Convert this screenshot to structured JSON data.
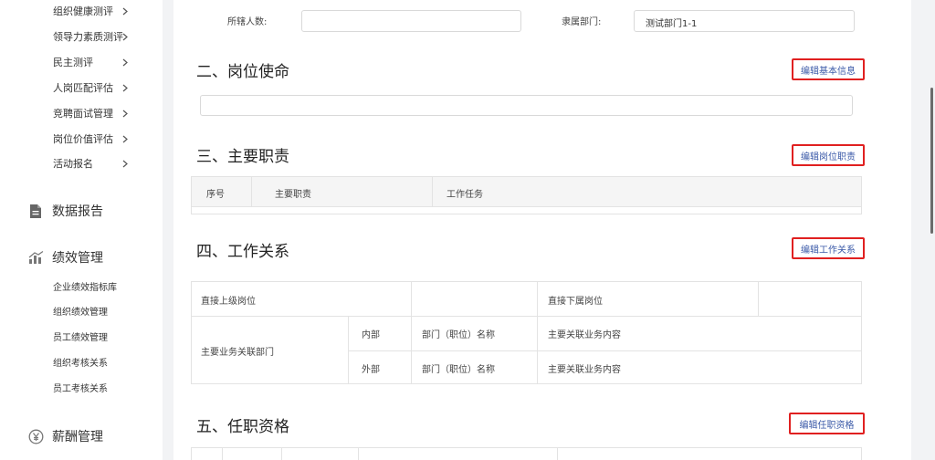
{
  "sidebar": {
    "sub_items": [
      {
        "label": "组织健康测评"
      },
      {
        "label": "领导力素质测评"
      },
      {
        "label": "民主测评"
      },
      {
        "label": "人岗匹配评估"
      },
      {
        "label": "竞聘面试管理"
      },
      {
        "label": "岗位价值评估"
      },
      {
        "label": "活动报名"
      }
    ],
    "data_report": {
      "label": "数据报告",
      "icon": "document-icon"
    },
    "performance": {
      "label": "绩效管理",
      "icon": "bar-chart-icon",
      "items": [
        {
          "label": "企业绩效指标库"
        },
        {
          "label": "组织绩效管理"
        },
        {
          "label": "员工绩效管理"
        },
        {
          "label": "组织考核关系"
        },
        {
          "label": "员工考核关系"
        }
      ]
    },
    "salary": {
      "label": "薪酬管理",
      "icon": "yen-icon"
    }
  },
  "basic_fields": {
    "headcount_label": "所辖人数:",
    "headcount_value": "",
    "department_label": "隶属部门:",
    "department_value": "测试部门1-1"
  },
  "sections": {
    "mission": {
      "title": "二、岗位使命",
      "edit_label": "编辑基本信息",
      "value": ""
    },
    "duties": {
      "title": "三、主要职责",
      "edit_label": "编辑岗位职责",
      "columns": [
        "序号",
        "主要职责",
        "工作任务"
      ]
    },
    "relations": {
      "title": "四、工作关系",
      "edit_label": "编辑工作关系",
      "superior_label": "直接上级岗位",
      "subordinate_label": "直接下属岗位",
      "related_label": "主要业务关联部门",
      "rows": [
        {
          "scope": "内部",
          "dept_label": "部门（职位）名称",
          "content_label": "主要关联业务内容"
        },
        {
          "scope": "外部",
          "dept_label": "部门（职位）名称",
          "content_label": "主要关联业务内容"
        }
      ]
    },
    "qualifications": {
      "title": "五、任职资格",
      "edit_label": "编辑任职资格"
    }
  },
  "colors": {
    "edit_text": "#3b5aa8",
    "highlight_border": "#e02020",
    "header_bg": "#f5f5f5"
  }
}
